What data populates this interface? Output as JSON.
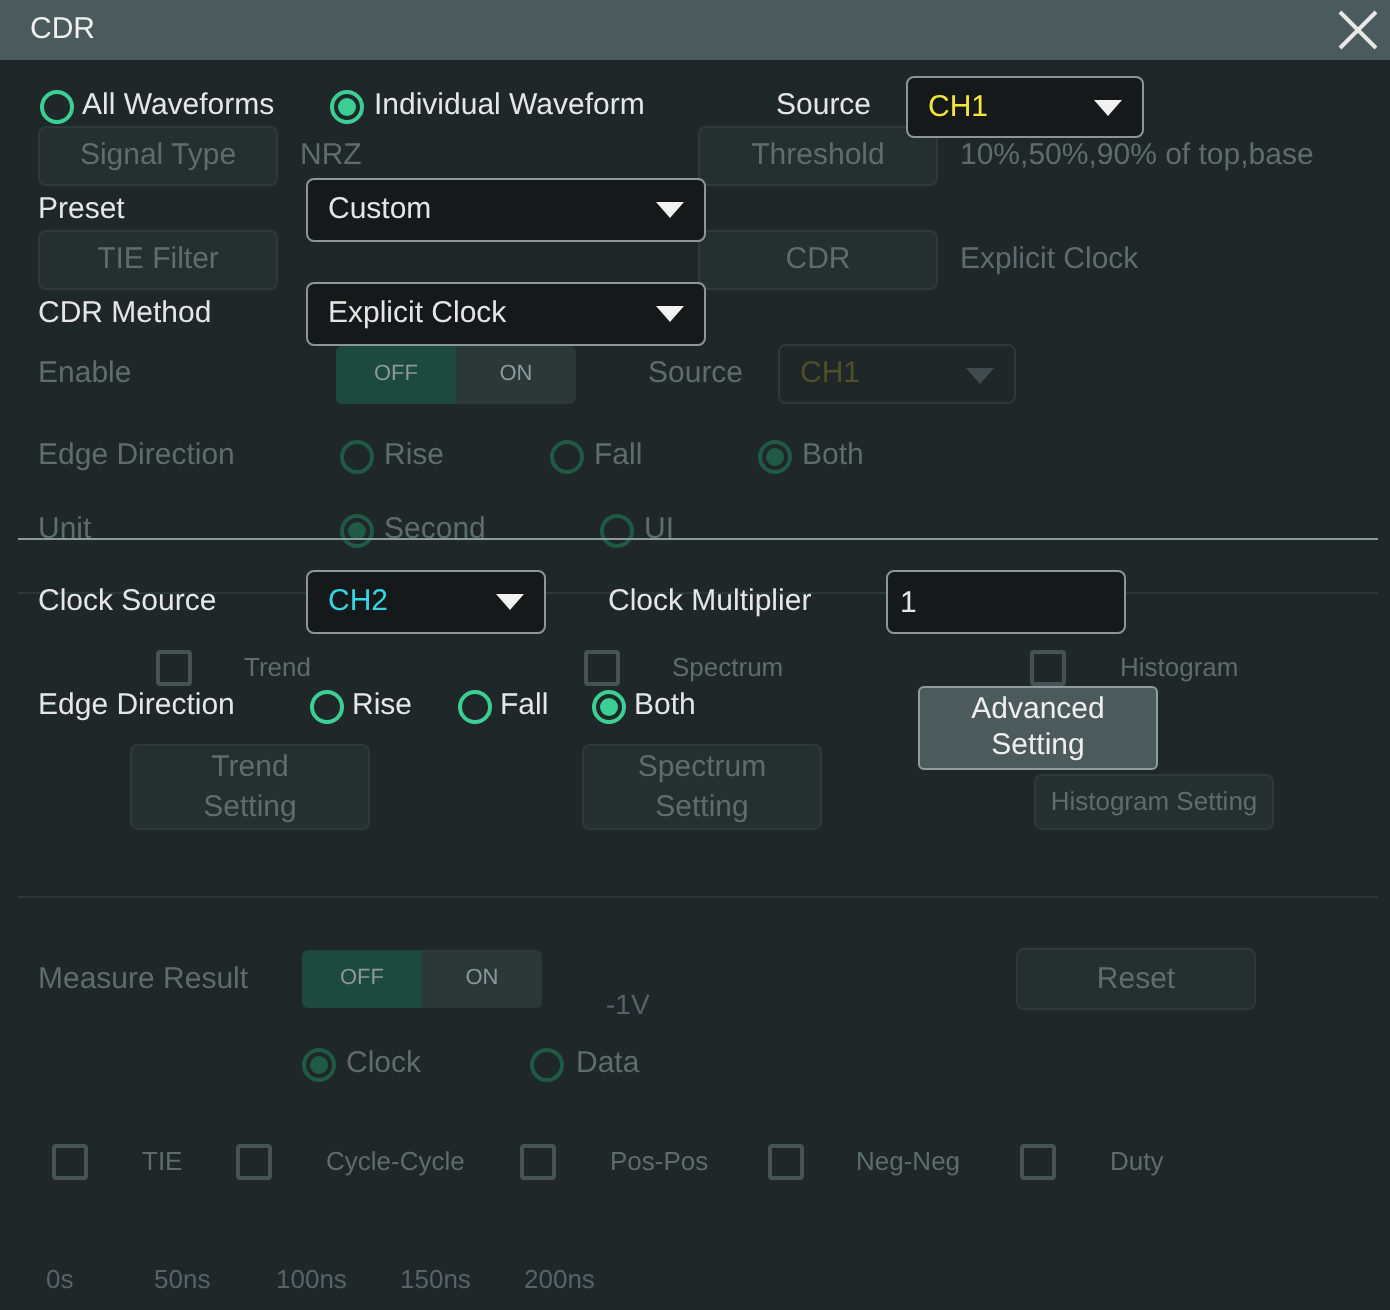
{
  "dialog": {
    "title": "CDR"
  },
  "background": {
    "signal_type": {
      "button": "Signal Type",
      "value": "NRZ"
    },
    "threshold": {
      "button": "Threshold",
      "value": "10%,50%,90% of top,base"
    },
    "tie_filter": {
      "button": "TIE Filter"
    },
    "cdr": {
      "button": "CDR",
      "value": "Explicit Clock"
    },
    "enable": {
      "label": "Enable",
      "toggle": {
        "on": false,
        "off_label": "OFF",
        "on_label": "ON"
      }
    },
    "source": {
      "label": "Source",
      "value": "CH1"
    },
    "edge_direction": {
      "label": "Edge Direction",
      "options": [
        {
          "label": "Rise",
          "selected": false
        },
        {
          "label": "Fall",
          "selected": false
        },
        {
          "label": "Both",
          "selected": true
        }
      ]
    },
    "unit": {
      "label": "Unit",
      "options": [
        {
          "label": "Second",
          "selected": true
        },
        {
          "label": "UI",
          "selected": false
        }
      ]
    },
    "analyses": [
      {
        "label": "Trend",
        "checked": false,
        "button": "Trend Setting"
      },
      {
        "label": "Spectrum",
        "checked": false,
        "button": "Spectrum Setting"
      },
      {
        "label": "Histogram",
        "checked": false,
        "button": "Histogram Setting"
      }
    ],
    "measure_result": {
      "label": "Measure Result",
      "toggle": {
        "on": false,
        "off_label": "OFF",
        "on_label": "ON"
      }
    },
    "reset_button": "Reset",
    "result_type": [
      {
        "label": "Clock",
        "selected": true
      },
      {
        "label": "Data",
        "selected": false
      }
    ],
    "measurements": [
      {
        "label": "TIE",
        "checked": false
      },
      {
        "label": "Cycle-Cycle",
        "checked": false
      },
      {
        "label": "Pos-Pos",
        "checked": false
      },
      {
        "label": "Neg-Neg",
        "checked": false
      },
      {
        "label": "Duty",
        "checked": false
      }
    ],
    "plot_label": "-1V",
    "time_axis": [
      "0s",
      "50ns",
      "100ns",
      "150ns",
      "200ns"
    ]
  },
  "waveform_scope": [
    {
      "label": "All Waveforms",
      "selected": false
    },
    {
      "label": "Individual Waveform",
      "selected": true
    }
  ],
  "source": {
    "label": "Source",
    "value": "CH1"
  },
  "preset": {
    "label": "Preset",
    "value": "Custom"
  },
  "cdr_method": {
    "label": "CDR Method",
    "value": "Explicit Clock"
  },
  "clock_source": {
    "label": "Clock Source",
    "value": "CH2"
  },
  "clock_multiplier": {
    "label": "Clock Multiplier",
    "value": "1"
  },
  "edge_direction": {
    "label": "Edge Direction",
    "options": [
      {
        "label": "Rise",
        "selected": false
      },
      {
        "label": "Fall",
        "selected": false
      },
      {
        "label": "Both",
        "selected": true
      }
    ]
  },
  "advanced_button": "Advanced Setting"
}
